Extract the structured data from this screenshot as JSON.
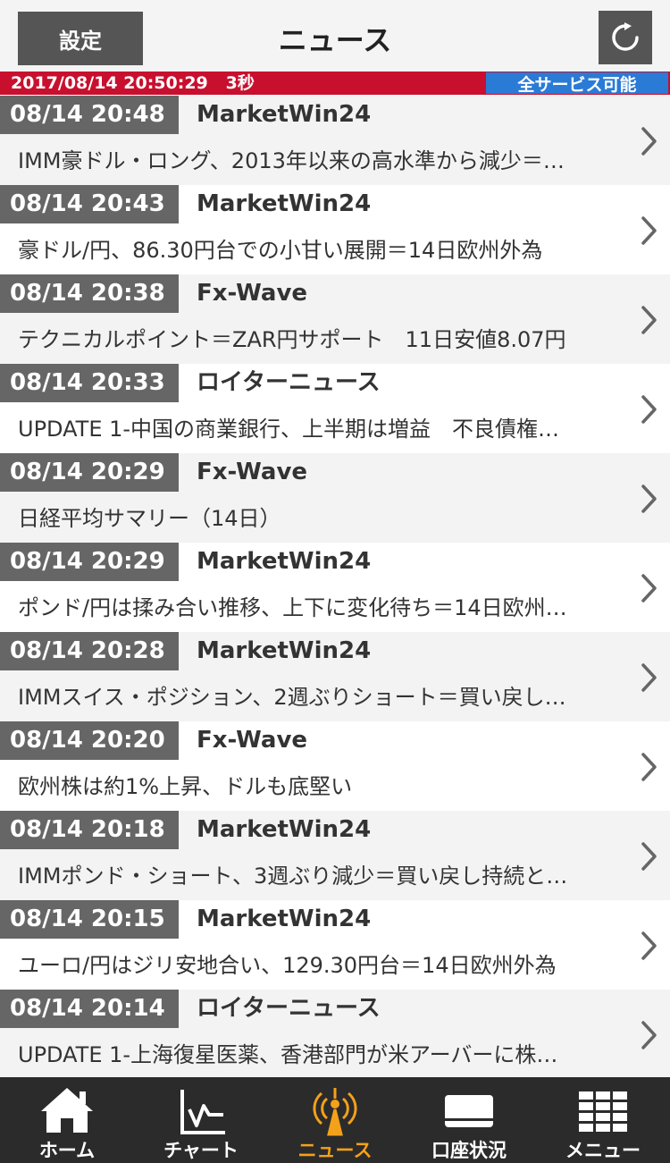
{
  "header": {
    "settings_label": "設定",
    "title": "ニュース"
  },
  "status": {
    "datetime": "2017/08/14 20:50:29",
    "interval": "3秒",
    "service": "全サービス可能"
  },
  "news": [
    {
      "time": "08/14 20:48",
      "source": "MarketWin24",
      "headline": "IMM豪ドル・ロング、2013年以来の高水準から減少＝…"
    },
    {
      "time": "08/14 20:43",
      "source": "MarketWin24",
      "headline": "豪ドル/円、86.30円台での小甘い展開＝14日欧州外為"
    },
    {
      "time": "08/14 20:38",
      "source": "Fx-Wave",
      "headline": "テクニカルポイント＝ZAR円サポート　11日安値8.07円"
    },
    {
      "time": "08/14 20:33",
      "source": "ロイターニュース",
      "headline": "UPDATE 1-中国の商業銀行、上半期は増益　不良債権…"
    },
    {
      "time": "08/14 20:29",
      "source": "Fx-Wave",
      "headline": "日経平均サマリー（14日）"
    },
    {
      "time": "08/14 20:29",
      "source": "MarketWin24",
      "headline": "ポンド/円は揉み合い推移、上下に変化待ち＝14日欧州…"
    },
    {
      "time": "08/14 20:28",
      "source": "MarketWin24",
      "headline": "IMMスイス・ポジション、2週ぶりショート＝買い戻し…"
    },
    {
      "time": "08/14 20:20",
      "source": "Fx-Wave",
      "headline": "欧州株は約1%上昇、ドルも底堅い"
    },
    {
      "time": "08/14 20:18",
      "source": "MarketWin24",
      "headline": "IMMポンド・ショート、3週ぶり減少＝買い戻し持続と…"
    },
    {
      "time": "08/14 20:15",
      "source": "MarketWin24",
      "headline": "ユーロ/円はジリ安地合い、129.30円台＝14日欧州外為"
    },
    {
      "time": "08/14 20:14",
      "source": "ロイターニュース",
      "headline": "UPDATE 1-上海復星医薬、香港部門が米アーバーに株…"
    }
  ],
  "tabs": [
    {
      "label": "ホーム",
      "icon": "home-icon"
    },
    {
      "label": "チャート",
      "icon": "chart-icon"
    },
    {
      "label": "ニュース",
      "icon": "news-antenna-icon",
      "active": true
    },
    {
      "label": "口座状況",
      "icon": "card-icon"
    },
    {
      "label": "メニュー",
      "icon": "grid-menu-icon"
    }
  ],
  "colors": {
    "status_red": "#c8102e",
    "service_blue": "#2a7bd6",
    "active_orange": "#f4a11a",
    "tabbar_bg": "#2b2b2b"
  }
}
